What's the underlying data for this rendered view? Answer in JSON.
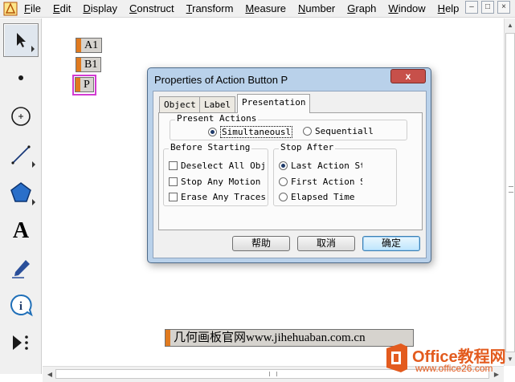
{
  "menubar": {
    "items": [
      {
        "u": "F",
        "rest": "ile"
      },
      {
        "u": "E",
        "rest": "dit"
      },
      {
        "u": "D",
        "rest": "isplay"
      },
      {
        "u": "C",
        "rest": "onstruct"
      },
      {
        "u": "T",
        "rest": "ransform"
      },
      {
        "u": "M",
        "rest": "easure"
      },
      {
        "u": "N",
        "rest": "umber"
      },
      {
        "u": "G",
        "rest": "raph"
      },
      {
        "u": "W",
        "rest": "indow"
      },
      {
        "u": "H",
        "rest": "elp"
      }
    ],
    "window_controls": [
      "–",
      "□",
      "×"
    ]
  },
  "toolbox": {
    "tools": [
      {
        "name": "arrow-tool-icon"
      },
      {
        "name": "point-tool-icon"
      },
      {
        "name": "compass-tool-icon"
      },
      {
        "name": "straightedge-tool-icon"
      },
      {
        "name": "polygon-tool-icon"
      },
      {
        "name": "text-tool-icon",
        "glyph": "A"
      },
      {
        "name": "marker-tool-icon"
      },
      {
        "name": "information-tool-icon",
        "glyph": "i"
      },
      {
        "name": "custom-tool-icon"
      }
    ]
  },
  "canvas": {
    "buttons": [
      "A1",
      "B1",
      "P"
    ],
    "watermark": "几何画板官网www.jihehuaban.com.cn"
  },
  "dialog": {
    "title": "Properties of Action Button P",
    "close": "x",
    "tabs": [
      "Object",
      "Label",
      "Presentation"
    ],
    "active_tab": "Presentation",
    "present_actions": {
      "title": "Present Actions",
      "options": [
        "Simultaneousl",
        "Sequentiall"
      ],
      "selected": "Simultaneousl"
    },
    "before_starting": {
      "title": "Before Starting",
      "options": [
        "Deselect All Obje",
        "Stop Any Motion",
        "Erase Any Traces"
      ]
    },
    "stop_after": {
      "title": "Stop After",
      "options": [
        "Last Action Sto",
        "First Action St",
        "Elapsed Time"
      ],
      "selected": "Last Action Sto"
    },
    "buttons": {
      "help": "帮助",
      "cancel": "取消",
      "ok": "确定"
    }
  },
  "logo": {
    "text": "Office教程网",
    "url": "www.office26.com"
  },
  "colors": {
    "accent_orange": "#e07a1f",
    "selection_magenta": "#d23bd2",
    "dialog_frame": "#b9d1ea",
    "logo_orange": "#e35b1e"
  }
}
